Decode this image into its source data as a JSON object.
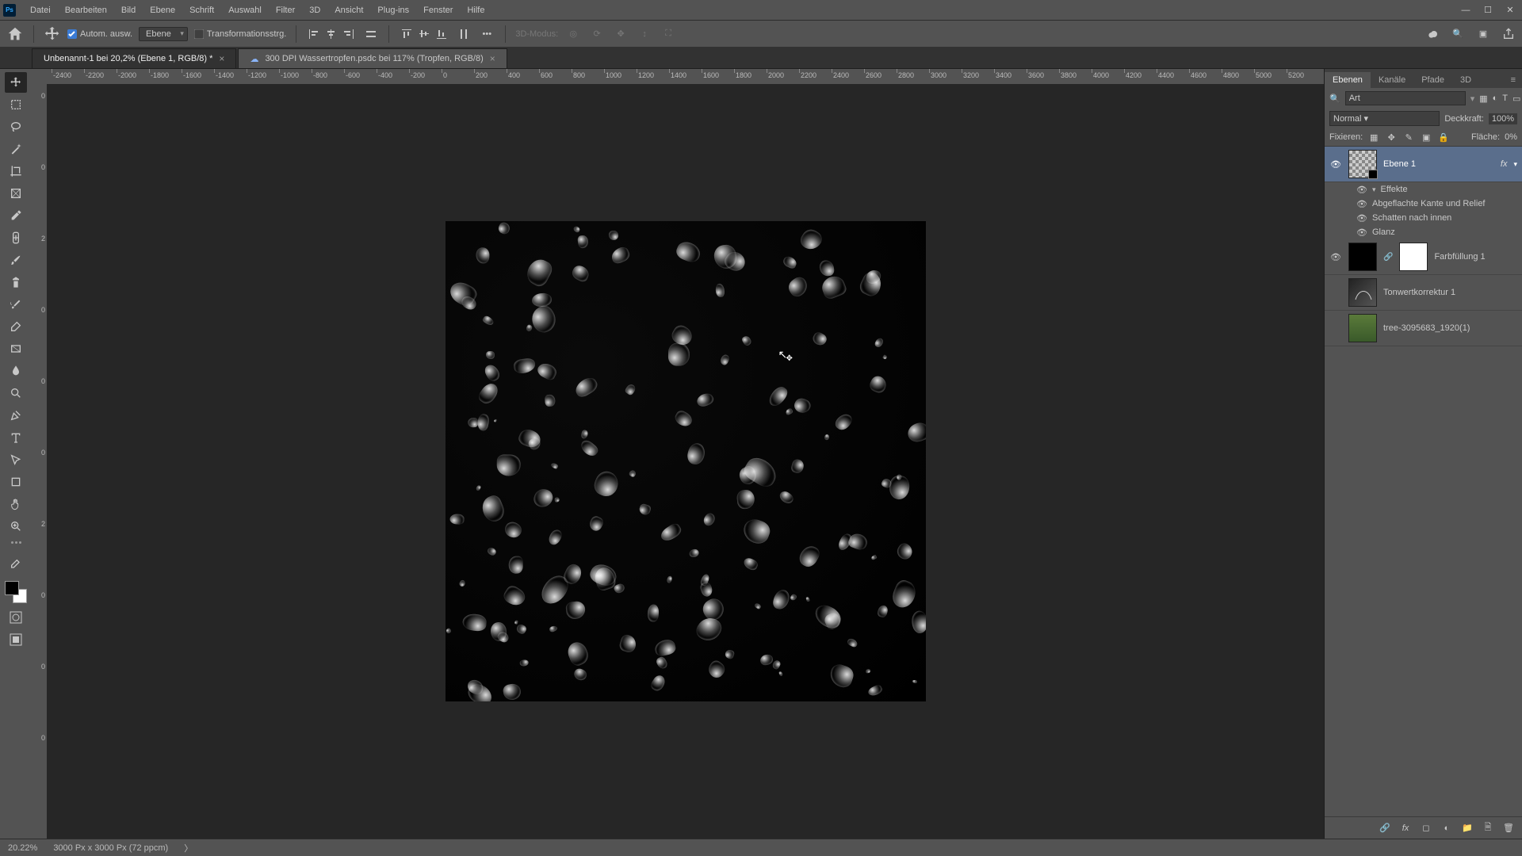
{
  "menu": [
    "Datei",
    "Bearbeiten",
    "Bild",
    "Ebene",
    "Schrift",
    "Auswahl",
    "Filter",
    "3D",
    "Ansicht",
    "Plug-ins",
    "Fenster",
    "Hilfe"
  ],
  "options": {
    "auto_select": "Autom. ausw.",
    "target": "Ebene",
    "transform": "Transformationsstrg.",
    "mode3d": "3D-Modus:"
  },
  "tabs": {
    "t1": "Unbenannt-1 bei 20,2% (Ebene 1, RGB/8) *",
    "t2": "300 DPI Wassertropfen.psdc bei 117% (Tropfen, RGB/8)"
  },
  "ruler_h": [
    "-2400",
    "-2200",
    "-2000",
    "-1800",
    "-1600",
    "-1400",
    "-1200",
    "-1000",
    "-800",
    "-600",
    "-400",
    "-200",
    "0",
    "200",
    "400",
    "600",
    "800",
    "1000",
    "1200",
    "1400",
    "1600",
    "1800",
    "2000",
    "2200",
    "2400",
    "2600",
    "2800",
    "3000",
    "3200",
    "3400",
    "3600",
    "3800",
    "4000",
    "4200",
    "4400",
    "4600",
    "4800",
    "5000",
    "5200"
  ],
  "ruler_v": [
    "0",
    "0",
    "2",
    "0",
    "0",
    "0",
    "2",
    "0",
    "0",
    "0"
  ],
  "panels": {
    "tabs": [
      "Ebenen",
      "Kanäle",
      "Pfade",
      "3D"
    ],
    "filter": "Art",
    "blend": "Normal",
    "opacity_lbl": "Deckkraft:",
    "opacity": "100%",
    "lock_lbl": "Fixieren:",
    "fill_lbl": "Fläche:",
    "fill": "0%"
  },
  "layers": [
    {
      "name": "Ebene 1",
      "fx": "fx",
      "eye": true,
      "sel": true,
      "thumb": "checker"
    },
    {
      "name": "Farbfüllung 1",
      "eye": true,
      "thumb": "black",
      "mask": true,
      "link": true
    },
    {
      "name": "Tonwertkorrektur 1",
      "eye": false,
      "thumb": "adj"
    },
    {
      "name": "tree-3095683_1920(1)",
      "eye": false,
      "thumb": "img"
    }
  ],
  "effects": {
    "header": "Effekte",
    "items": [
      "Abgeflachte Kante und Relief",
      "Schatten nach innen",
      "Glanz"
    ]
  },
  "status": {
    "zoom": "20.22%",
    "docinfo": "3000 Px x 3000 Px (72 ppcm)"
  }
}
